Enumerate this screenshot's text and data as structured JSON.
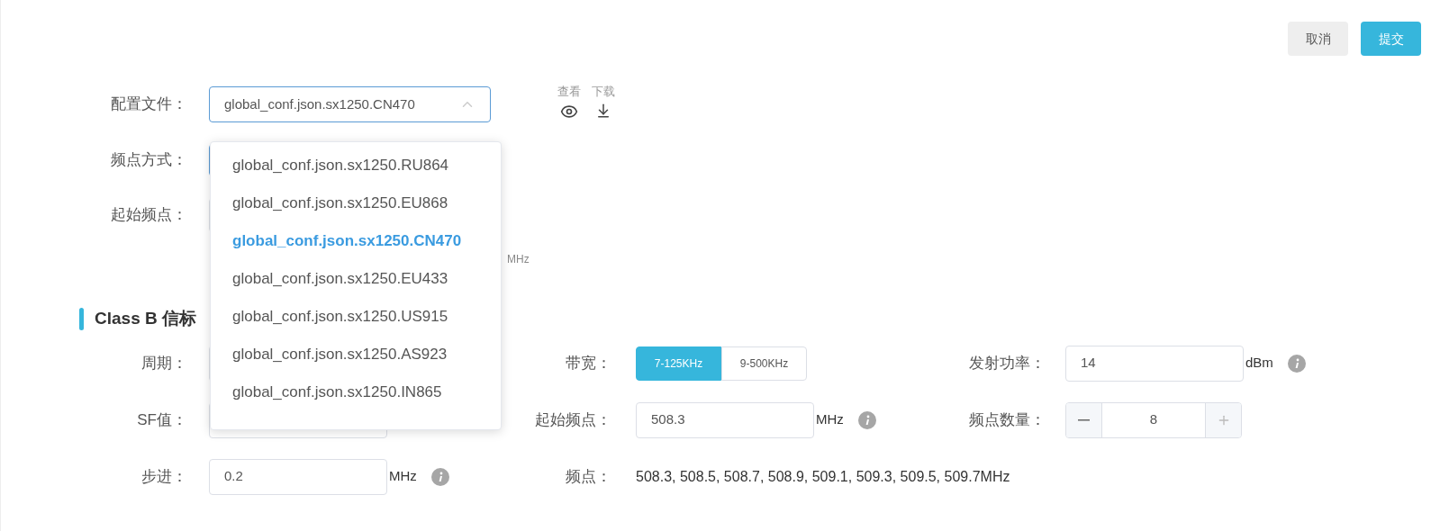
{
  "actions": [
    {
      "label": "取消",
      "kind": "secondary"
    },
    {
      "label": "提交",
      "kind": "primary"
    }
  ],
  "config_file": {
    "label": "配置文件：",
    "value": "global_conf.json.sx1250.CN470",
    "expanded": true,
    "view_label": "查看",
    "download_label": "下载",
    "options": [
      {
        "label": "global_conf.json.sx1250.RU864",
        "selected": false
      },
      {
        "label": "global_conf.json.sx1250.EU868",
        "selected": false
      },
      {
        "label": "global_conf.json.sx1250.CN470",
        "selected": true
      },
      {
        "label": "global_conf.json.sx1250.EU433",
        "selected": false
      },
      {
        "label": "global_conf.json.sx1250.US915",
        "selected": false
      },
      {
        "label": "global_conf.json.sx1250.AS923",
        "selected": false
      },
      {
        "label": "global_conf.json.sx1250.IN865",
        "selected": false
      }
    ]
  },
  "frequency_mode": {
    "label": "频点方式："
  },
  "start_frequency": {
    "label": "起始频点：",
    "unit": "MHz"
  },
  "section_title": "Class B 信标",
  "beacon_fields": [
    {
      "kind": "input",
      "label": "周期："
    },
    {
      "kind": "segmented",
      "label": "带宽：",
      "options": [
        {
          "label": "7-125KHz",
          "selected": true
        },
        {
          "label": "9-500KHz",
          "selected": false
        }
      ]
    },
    {
      "kind": "input",
      "label": "发射功率：",
      "value": "14",
      "unit": "dBm",
      "info": true
    },
    {
      "kind": "input",
      "label": "SF值："
    },
    {
      "kind": "input",
      "label": "起始频点：",
      "value": "508.3",
      "unit": "MHz",
      "info": true
    },
    {
      "kind": "stepper",
      "label": "频点数量：",
      "value": "8"
    },
    {
      "kind": "input",
      "label": "步进：",
      "value": "0.2",
      "unit": "MHz",
      "info": true
    },
    {
      "kind": "text",
      "label": "频点：",
      "value": "508.3, 508.5, 508.7, 508.9, 509.1, 509.3, 509.5, 509.7MHz"
    }
  ]
}
